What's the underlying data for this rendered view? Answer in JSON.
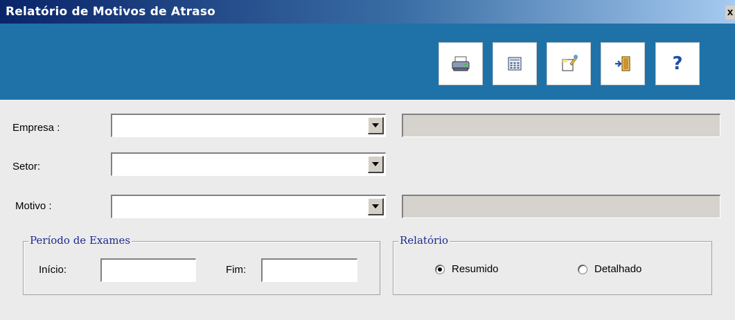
{
  "window": {
    "title": "Relatório de Motivos de Atraso",
    "close_glyph": "x"
  },
  "toolbar": {
    "buttons": [
      {
        "name": "print-button",
        "icon": "printer-icon"
      },
      {
        "name": "calculator-button",
        "icon": "calculator-icon"
      },
      {
        "name": "edit-button",
        "icon": "edit-note-icon"
      },
      {
        "name": "exit-button",
        "icon": "exit-door-icon"
      },
      {
        "name": "help-button",
        "icon": "help-icon",
        "glyph": "?"
      }
    ]
  },
  "form": {
    "empresa_label": "Empresa :",
    "setor_label": "Setor:",
    "motivo_label": "Motivo :",
    "empresa_value": "",
    "setor_value": "",
    "motivo_value": "",
    "empresa_desc": "",
    "motivo_desc": ""
  },
  "periodo": {
    "legend": "Período de Exames",
    "inicio_label": "Início:",
    "fim_label": "Fim:",
    "inicio_value": "",
    "fim_value": ""
  },
  "relatorio": {
    "legend": "Relatório",
    "options": [
      {
        "label": "Resumido",
        "checked": true
      },
      {
        "label": "Detalhado",
        "checked": false
      }
    ]
  },
  "colors": {
    "titlebar_start": "#0a246a",
    "titlebar_end": "#a6caf0",
    "toolbar": "#1e72a8",
    "legend_text": "#1c2a8c"
  }
}
